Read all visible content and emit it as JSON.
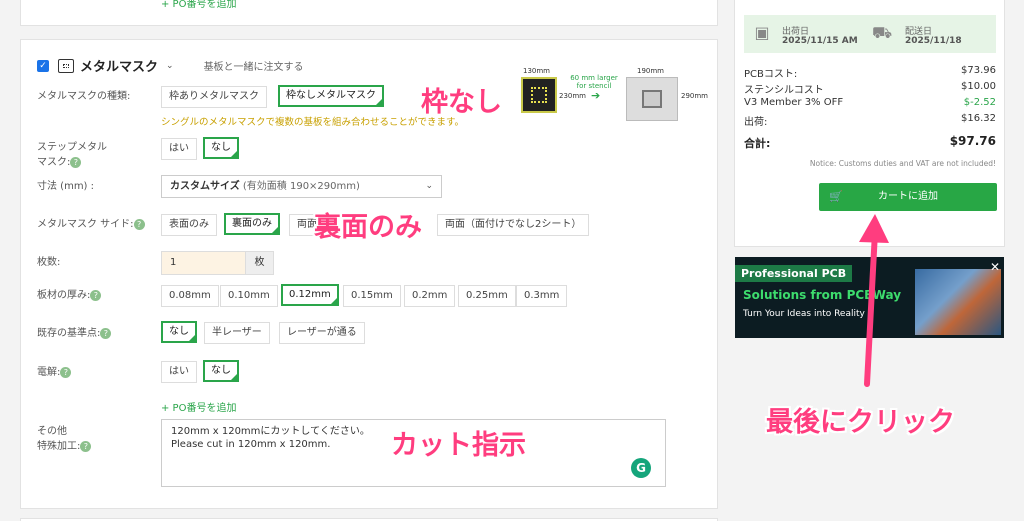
{
  "top_card": {
    "add_po": "+ PO番号を追加"
  },
  "stencil": {
    "enabled": true,
    "title": "メタルマスク",
    "subtitle": "基板と一緒に注文する",
    "type_label": "メタルマスクの種類:",
    "type_options": [
      "枠ありメタルマスク",
      "枠なしメタルマスク"
    ],
    "type_hint": "シングルのメタルマスクで複数の基板を組み合わせることができます。",
    "step_label_1": "ステップメタル",
    "step_label_2": "マスク:",
    "step_options": [
      "はい",
      "なし"
    ],
    "size_label": "寸法 (mm) :",
    "size_value": "カスタムサイズ",
    "size_note": "(有効面積 190×290mm)",
    "side_label": "メタルマスク サイド:",
    "side_options": [
      "表面のみ",
      "裏面のみ",
      "両面",
      "両面（面付けでなし2シート）"
    ],
    "qty_label": "枚数:",
    "qty_value": "1",
    "qty_unit": "枚",
    "thickness_label": "板材の厚み:",
    "thickness_options": [
      "0.08mm",
      "0.10mm",
      "0.12mm",
      "0.15mm",
      "0.2mm",
      "0.25mm",
      "0.3mm"
    ],
    "fiducial_label": "既存の基準点:",
    "fiducial_options": [
      "なし",
      "半レーザー",
      "レーザーが通る"
    ],
    "electro_label": "電解:",
    "electro_options": [
      "はい",
      "なし"
    ],
    "add_po": "+ PO番号を追加",
    "other_label_1": "その他",
    "other_label_2": "特殊加工:",
    "other_text_1": "120mm x 120mmにカットしてください。",
    "other_text_2": "Please cut in 120mm x 120mm.",
    "grammarly": "G"
  },
  "diagram": {
    "w1": "130mm",
    "h1": "230mm",
    "note_1": "60 mm larger",
    "note_2": "for stencil",
    "w2": "190mm",
    "h2": "290mm"
  },
  "annotations": {
    "frameless": "枠なし",
    "back_only": "裏面のみ",
    "cut": "カット指示",
    "click_last": "最後にクリック"
  },
  "summary": {
    "ship_label": "出荷日",
    "ship_date": "2025/11/15 AM",
    "deliver_label": "配送日",
    "deliver_date": "2025/11/18",
    "rows": [
      {
        "label": "PCBコスト:",
        "value": "$73.96"
      },
      {
        "label": "ステンシルコスト",
        "value": "$10.00"
      },
      {
        "label": "V3 Member 3% OFF",
        "value": "$-2.52"
      },
      {
        "label": "出荷:",
        "value": "$16.32"
      }
    ],
    "total_label": "合計:",
    "total_value": "$97.76",
    "notice": "Notice: Customs duties and VAT are not included!",
    "cart_button": "カートに追加"
  },
  "banner": {
    "line1": "Professional PCB",
    "line2": "Solutions from PCBWay",
    "line3": "Turn Your Ideas into Reality",
    "close": "✕"
  },
  "colors": {
    "accent": "#2aa54a",
    "annotation": "#ff3d7f",
    "hint": "#c8a000"
  }
}
